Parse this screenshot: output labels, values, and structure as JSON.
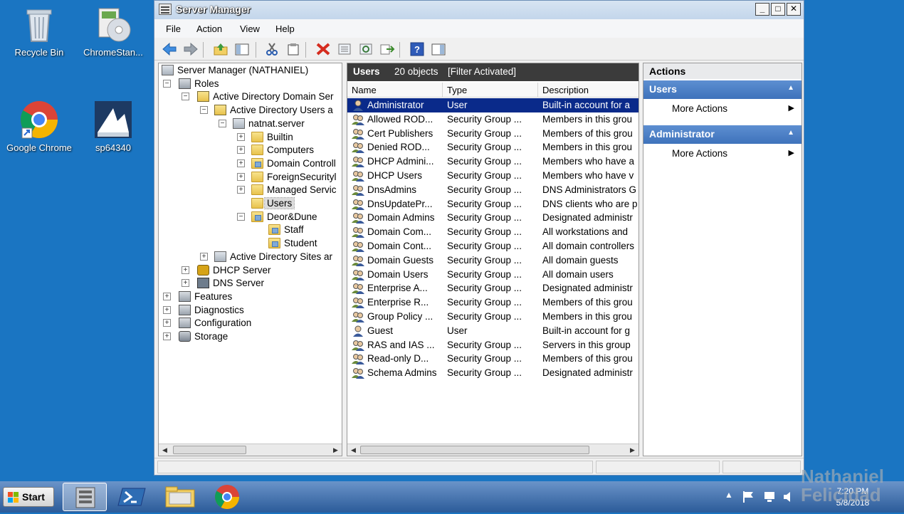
{
  "desktop": {
    "icons": [
      {
        "label": "Recycle Bin",
        "icon": "recycle-bin-icon"
      },
      {
        "label": "ChromeStan...",
        "icon": "installer-icon"
      },
      {
        "label": "Google Chrome",
        "icon": "chrome-icon"
      },
      {
        "label": "sp64340",
        "icon": "app-icon"
      }
    ]
  },
  "window": {
    "title": "Server Manager",
    "controls": {
      "minimize": "_",
      "maximize": "□",
      "close": "✕"
    },
    "menu": [
      "File",
      "Action",
      "View",
      "Help"
    ]
  },
  "tree": {
    "items": [
      {
        "label": "Server Manager (NATHANIEL)",
        "icon": "server-icon"
      },
      {
        "label": "Roles",
        "icon": "roles-icon",
        "expander": "−"
      },
      {
        "label": "Active Directory Domain Ser",
        "icon": "ad-icon",
        "expander": "−"
      },
      {
        "label": "Active Directory Users a",
        "icon": "ad-users-icon",
        "expander": "−"
      },
      {
        "label": "natnat.server",
        "icon": "domain-icon",
        "expander": "−"
      },
      {
        "label": "Builtin",
        "icon": "folder-icon",
        "expander": "+"
      },
      {
        "label": "Computers",
        "icon": "folder-icon",
        "expander": "+"
      },
      {
        "label": "Domain Controll",
        "icon": "ou-icon",
        "expander": "+"
      },
      {
        "label": "ForeignSecurityl",
        "icon": "folder-icon",
        "expander": "+"
      },
      {
        "label": "Managed Servic",
        "icon": "folder-icon",
        "expander": "+"
      },
      {
        "label": "Users",
        "icon": "folder-icon"
      },
      {
        "label": "Deor&Dune",
        "icon": "ou-icon",
        "expander": "−"
      },
      {
        "label": "Staff",
        "icon": "ou-icon"
      },
      {
        "label": "Student",
        "icon": "ou-icon"
      },
      {
        "label": "Active Directory Sites ar",
        "icon": "sites-icon",
        "expander": "+"
      },
      {
        "label": "DHCP Server",
        "icon": "dhcp-icon",
        "expander": "+"
      },
      {
        "label": "DNS Server",
        "icon": "dns-icon",
        "expander": "+"
      },
      {
        "label": "Features",
        "icon": "features-icon",
        "expander": "+"
      },
      {
        "label": "Diagnostics",
        "icon": "diagnostics-icon",
        "expander": "+"
      },
      {
        "label": "Configuration",
        "icon": "configuration-icon",
        "expander": "+"
      },
      {
        "label": "Storage",
        "icon": "storage-icon",
        "expander": "+"
      }
    ]
  },
  "list": {
    "title": "Users",
    "count": "20 objects",
    "filter": "[Filter Activated]",
    "columns": [
      "Name",
      "Type",
      "Description"
    ],
    "rows": [
      {
        "name": "Administrator",
        "type": "User",
        "description": "Built-in account for a",
        "kind": "user"
      },
      {
        "name": "Allowed ROD...",
        "type": "Security Group ...",
        "description": "Members in this grou",
        "kind": "group"
      },
      {
        "name": "Cert Publishers",
        "type": "Security Group ...",
        "description": "Members of this grou",
        "kind": "group"
      },
      {
        "name": "Denied ROD...",
        "type": "Security Group ...",
        "description": "Members in this grou",
        "kind": "group"
      },
      {
        "name": "DHCP Admini...",
        "type": "Security Group ...",
        "description": "Members who have a",
        "kind": "group"
      },
      {
        "name": "DHCP Users",
        "type": "Security Group ...",
        "description": "Members who have v",
        "kind": "group"
      },
      {
        "name": "DnsAdmins",
        "type": "Security Group ...",
        "description": "DNS Administrators G",
        "kind": "group"
      },
      {
        "name": "DnsUpdatePr...",
        "type": "Security Group ...",
        "description": "DNS clients who are p",
        "kind": "group"
      },
      {
        "name": "Domain Admins",
        "type": "Security Group ...",
        "description": "Designated administr",
        "kind": "group"
      },
      {
        "name": "Domain Com...",
        "type": "Security Group ...",
        "description": "All workstations and",
        "kind": "group"
      },
      {
        "name": "Domain Cont...",
        "type": "Security Group ...",
        "description": "All domain controllers",
        "kind": "group"
      },
      {
        "name": "Domain Guests",
        "type": "Security Group ...",
        "description": "All domain guests",
        "kind": "group"
      },
      {
        "name": "Domain Users",
        "type": "Security Group ...",
        "description": "All domain users",
        "kind": "group"
      },
      {
        "name": "Enterprise A...",
        "type": "Security Group ...",
        "description": "Designated administr",
        "kind": "group"
      },
      {
        "name": "Enterprise R...",
        "type": "Security Group ...",
        "description": "Members of this grou",
        "kind": "group"
      },
      {
        "name": "Group Policy ...",
        "type": "Security Group ...",
        "description": "Members in this grou",
        "kind": "group"
      },
      {
        "name": "Guest",
        "type": "User",
        "description": "Built-in account for g",
        "kind": "user"
      },
      {
        "name": "RAS and IAS ...",
        "type": "Security Group ...",
        "description": "Servers in this group",
        "kind": "group"
      },
      {
        "name": "Read-only D...",
        "type": "Security Group ...",
        "description": "Members of this grou",
        "kind": "group"
      },
      {
        "name": "Schema Admins",
        "type": "Security Group ...",
        "description": "Designated administr",
        "kind": "group"
      }
    ]
  },
  "actions": {
    "title": "Actions",
    "sections": [
      {
        "title": "Users",
        "items": [
          "More Actions"
        ]
      },
      {
        "title": "Administrator",
        "items": [
          "More Actions"
        ]
      }
    ]
  },
  "taskbar": {
    "start_label": "Start",
    "apps": [
      "server-manager-icon",
      "powershell-icon",
      "explorer-icon",
      "chrome-icon"
    ],
    "clock": {
      "time": "7:20 PM",
      "date": "5/8/2018"
    }
  },
  "watermark": {
    "line1": "Nathaniel",
    "line2": "Felicidad"
  },
  "colors": {
    "desktop": "#1a75c2",
    "selection": "#0a2a8a",
    "action_header": "#4a7dc3"
  }
}
